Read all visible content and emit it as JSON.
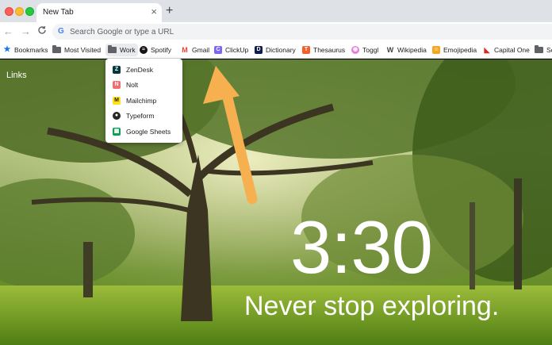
{
  "window": {
    "tab_title": "New Tab",
    "tab_close_icon": "×",
    "new_tab_icon": "+"
  },
  "toolbar": {
    "back_icon": "←",
    "forward_icon": "→",
    "reload_icon": "C",
    "google_icon": "G",
    "omnibox_placeholder": "Search Google or type a URL"
  },
  "bookmarks": [
    {
      "label": "Bookmarks",
      "icon": "star-icon",
      "glyph": "★",
      "color": "#1a73e8"
    },
    {
      "label": "Most Visited",
      "icon": "folder-icon",
      "glyph": "",
      "color": "#5f6368"
    },
    {
      "label": "Work",
      "icon": "folder-icon",
      "glyph": "",
      "color": "#5f6368"
    },
    {
      "label": "Spotify",
      "icon": "spotify-icon",
      "glyph": "≈",
      "color": "#191414"
    },
    {
      "label": "Gmail",
      "icon": "gmail-icon",
      "glyph": "M",
      "color": "#ea4335"
    },
    {
      "label": "ClickUp",
      "icon": "clickup-icon",
      "glyph": "C",
      "color": "#7b68ee"
    },
    {
      "label": "Dictionary",
      "icon": "dictionary-icon",
      "glyph": "D",
      "color": "#0f1c4d"
    },
    {
      "label": "Thesaurus",
      "icon": "thesaurus-icon",
      "glyph": "T",
      "color": "#f35f2b"
    },
    {
      "label": "Toggl",
      "icon": "toggl-icon",
      "glyph": "◉",
      "color": "#e57cd8"
    },
    {
      "label": "Wikipedia",
      "icon": "wikipedia-icon",
      "glyph": "W",
      "color": "#444444"
    },
    {
      "label": "Emojipedia",
      "icon": "emojipedia-icon",
      "glyph": "☺",
      "color": "#f5a623"
    },
    {
      "label": "Capital One",
      "icon": "capitalone-icon",
      "glyph": "◣",
      "color": "#d22e1e"
    },
    {
      "label": "Sc",
      "icon": "folder-icon",
      "glyph": "",
      "color": "#5f6368"
    }
  ],
  "work_menu": [
    {
      "label": "ZenDesk",
      "icon": "zendesk-icon",
      "glyph": "Z",
      "color": "#03363d"
    },
    {
      "label": "Nolt",
      "icon": "nolt-icon",
      "glyph": "N",
      "color": "#f26d6d"
    },
    {
      "label": "Mailchimp",
      "icon": "mailchimp-icon",
      "glyph": "M",
      "color": "#ffe01b"
    },
    {
      "label": "Typeform",
      "icon": "typeform-icon",
      "glyph": "●",
      "color": "#262627"
    },
    {
      "label": "Google Sheets",
      "icon": "google-sheets-icon",
      "glyph": "▦",
      "color": "#0f9d58"
    }
  ],
  "page": {
    "links_label": "Links",
    "clock": "3:30",
    "motto": "Never stop exploring."
  },
  "colors": {
    "arrow": "#f7b04f",
    "tabstrip": "#dee1e6"
  }
}
